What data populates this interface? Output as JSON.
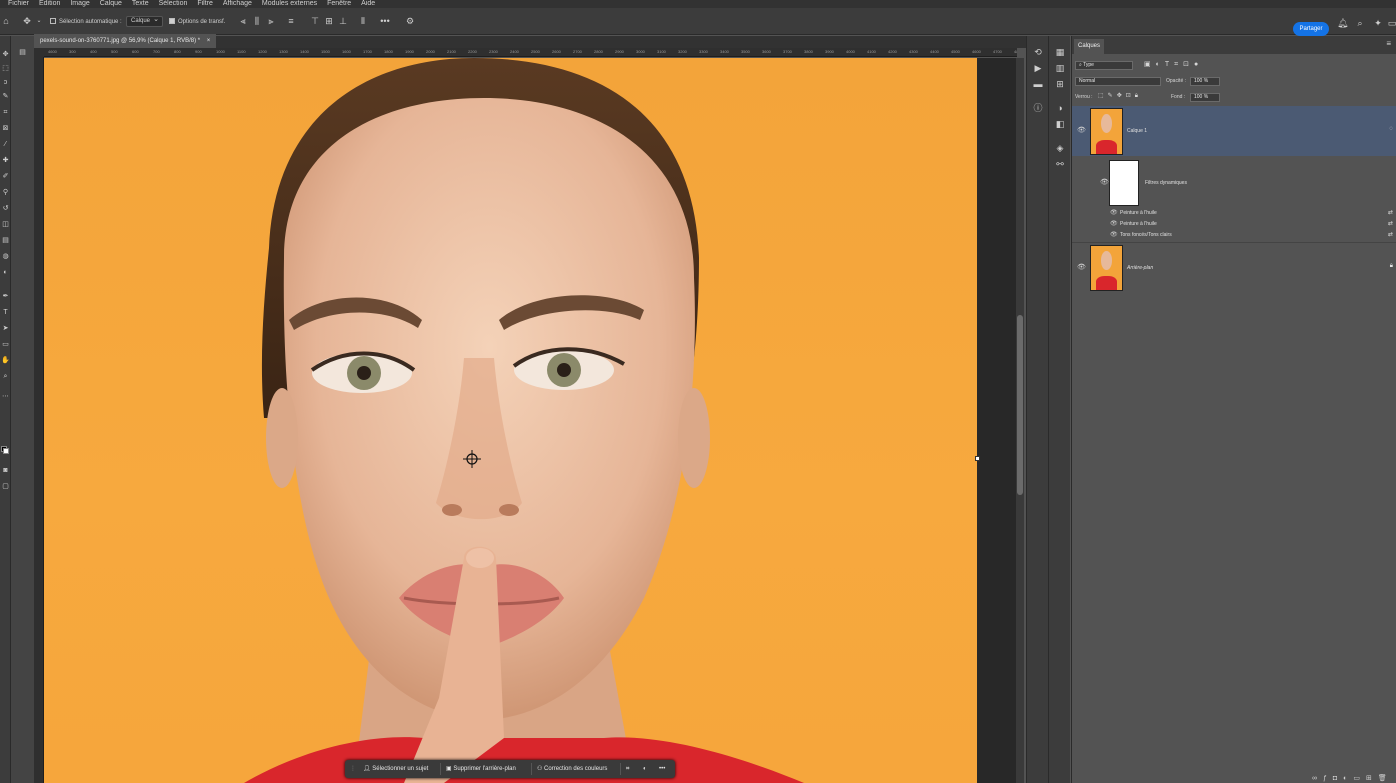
{
  "menu": [
    "Fichier",
    "Edition",
    "Image",
    "Calque",
    "Texte",
    "Sélection",
    "Filtre",
    "Affichage",
    "Modules externes",
    "Fenêtre",
    "Aide"
  ],
  "options_bar": {
    "auto_select_label": "Sélection automatique :",
    "auto_select_target": "Calque",
    "transform_label": "Options de transf.",
    "more": "•••",
    "share_label": "Partager"
  },
  "document": {
    "tab_title": "pexels-sound-on-3760771.jpg @ 56,9% (Calque 1, RVB/8) *",
    "tab_close": "×",
    "ruler_ticks": [
      "4600",
      "300",
      "400",
      "500",
      "600",
      "700",
      "800",
      "900",
      "1000",
      "1100",
      "1200",
      "1300",
      "1400",
      "1500",
      "1600",
      "1700",
      "1800",
      "1900",
      "2000",
      "2100",
      "2200",
      "2300",
      "2400",
      "2500",
      "2600",
      "2700",
      "2800",
      "2900",
      "3000",
      "3100",
      "3200",
      "3300",
      "3400",
      "3500",
      "3600",
      "3700",
      "3800",
      "3900",
      "4000",
      "4100",
      "4200",
      "4300",
      "4400",
      "4500",
      "4600",
      "4700",
      "4800"
    ]
  },
  "context_task_bar": {
    "select_subject": "Sélectionner un sujet",
    "remove_bg": "Supprimer l'arrière-plan",
    "color_correction": "Correction des couleurs",
    "more": "•••"
  },
  "layers_panel": {
    "tab": "Calques",
    "filter_kind": "Type",
    "blend_mode": "Normal",
    "opacity_label": "Opacité :",
    "opacity_value": "100 %",
    "lock_label": "Verrou :",
    "fill_label": "Fond :",
    "fill_value": "100 %",
    "layers": [
      {
        "name": "Calque 1",
        "selected": true
      },
      {
        "name": "Filtres dynamiques"
      },
      {
        "name": "Peinture à l'huile"
      },
      {
        "name": "Peinture à l'huile"
      },
      {
        "name": "Tons foncés/Tons clairs"
      },
      {
        "name": "Arrière-plan",
        "locked": true
      }
    ]
  },
  "colors": {
    "accent": "#1473e6",
    "selected_row": "#4b5a73",
    "background_photo": "#f6a63c"
  }
}
